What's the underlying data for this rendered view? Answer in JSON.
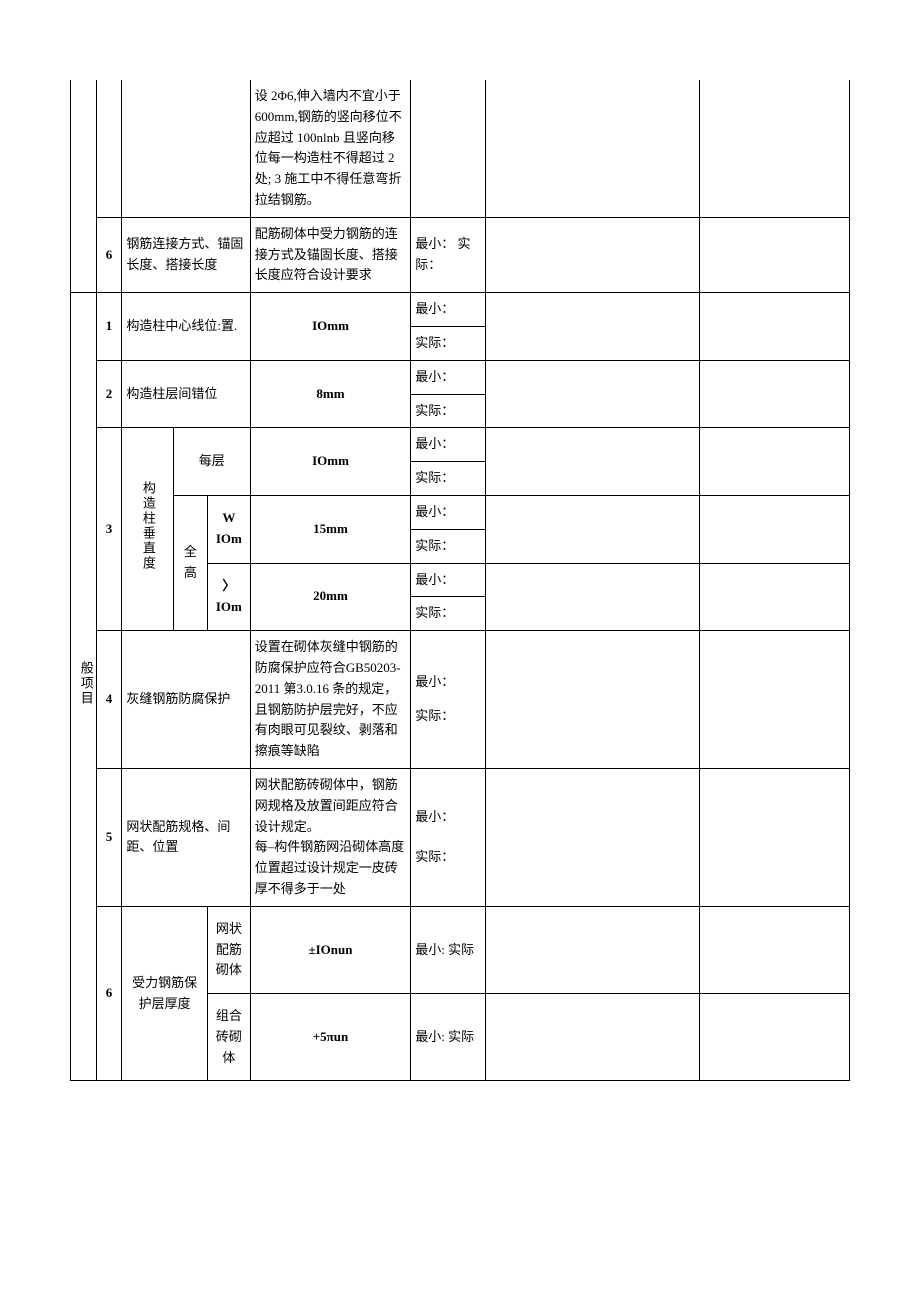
{
  "category": "般项目",
  "rows": {
    "r_top_spec": "设 2Φ6,伸入墙内不宜小于 600mm,钢筋的竖向移位不应超过 100nlnb 且竖向移位每一构造柱不得超过 2 处;\n3 施工中不得任意弯折拉结钢筋。",
    "r6a": {
      "num": "6",
      "name": "钢筋连接方式、锚固长度、搭接长度",
      "spec": "配筋砌体中受力钢筋的连接方式及锚固长度、搭接长度应符合设计要求",
      "minactual": "最小：  实际："
    },
    "r1": {
      "num": "1",
      "name": "构造柱中心线位:置.",
      "spec": "IOmm",
      "min": "最小：",
      "actual": "实际："
    },
    "r2": {
      "num": "2",
      "name": "构造柱层间错位",
      "spec": "8mm",
      "min": "最小：",
      "actual": "实际："
    },
    "r3": {
      "num": "3",
      "name": "构造柱垂直度",
      "sub1_label": "每层",
      "sub1_spec": "IOmm",
      "sub1_min": "最小：",
      "sub1_actual": "实际：",
      "sub2_label": "全高",
      "sub2a_label": "W IOm",
      "sub2a_spec": "15mm",
      "sub2a_min": "最小：",
      "sub2a_actual": "实际：",
      "sub2b_label": "〉IOm",
      "sub2b_spec": "20mm",
      "sub2b_min": "最小：",
      "sub2b_actual": "实际："
    },
    "r4": {
      "num": "4",
      "name": "灰缝钢筋防腐保护",
      "spec": "设置在砌体灰缝中钢筋的防腐保护应符合GB50203-2011 第3.0.16 条的规定，且钢筋防护层完好，不应有肉眼可见裂纹、剥落和擦痕等缺陷",
      "min": "最小：",
      "actual": "实际："
    },
    "r5": {
      "num": "5",
      "name": "网状配筋规格、间距、位置",
      "spec": "网状配筋砖砌体中，钢筋网规格及放置间距应符合设计规定。\n每–构件钢筋网沿砌体高度位置超过设计规定一皮砖厚不得多于一处",
      "min": "最小：",
      "actual": "实际："
    },
    "r6b": {
      "num": "6",
      "name": "受力钢筋保护层厚度",
      "sub1_label": "网状配筋砌体",
      "sub1_spec": "±IOnun",
      "sub1_minactual": "最小: 实际",
      "sub2_label": "组合砖砌体",
      "sub2_spec": "+5πun",
      "sub2_minactual": "最小: 实际"
    }
  }
}
